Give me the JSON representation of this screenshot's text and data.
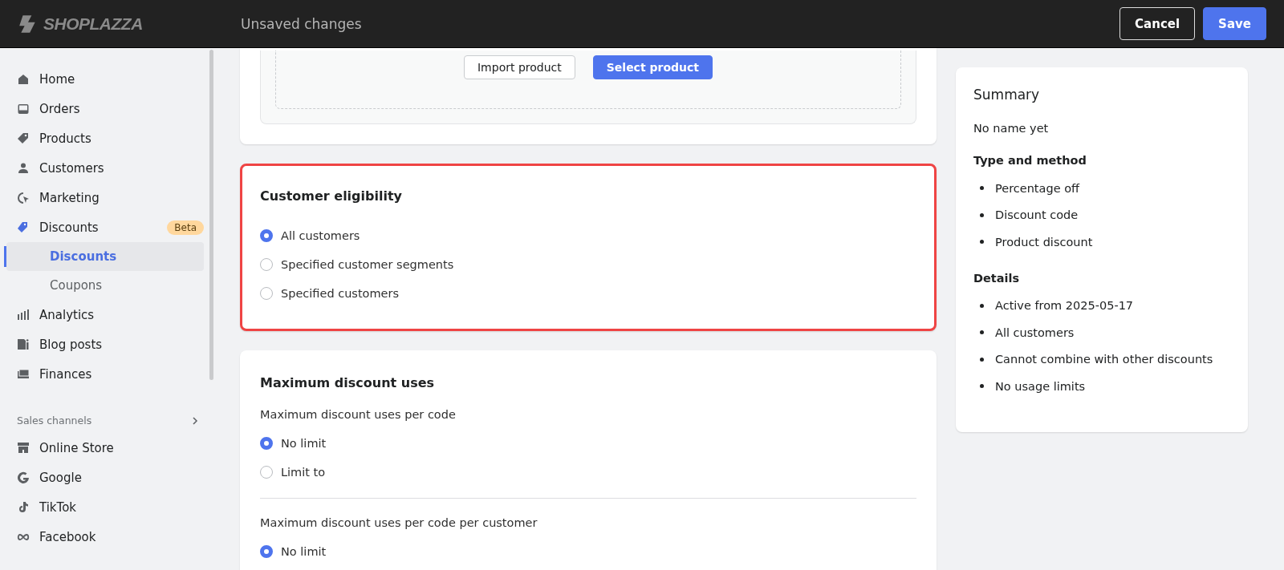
{
  "topbar": {
    "logo": "SHOPLAZZA",
    "title": "Unsaved changes",
    "buttons": [
      {
        "label": "Cancel",
        "kind": "secondary"
      },
      {
        "label": "Save",
        "kind": "primary"
      }
    ]
  },
  "sidebar": {
    "items": [
      {
        "label": "Home",
        "selected": false
      },
      {
        "label": "Orders",
        "selected": false
      },
      {
        "label": "Products",
        "selected": false
      },
      {
        "label": "Customers",
        "selected": false
      },
      {
        "label": "Marketing",
        "selected": false
      },
      {
        "label": "Discounts",
        "selected": false,
        "badge": "Beta",
        "children": [
          {
            "label": "Discounts",
            "selected": true
          },
          {
            "label": "Coupons",
            "selected": false
          }
        ]
      },
      {
        "label": "Analytics",
        "selected": false
      },
      {
        "label": "Blog posts",
        "selected": false
      },
      {
        "label": "Finances",
        "selected": false
      }
    ],
    "section": "Sales channels",
    "channels": [
      {
        "label": "Online Store"
      },
      {
        "label": "Google"
      },
      {
        "label": "TikTok"
      },
      {
        "label": "Facebook"
      }
    ]
  },
  "product_card": {
    "buttons": [
      {
        "label": "Import product",
        "kind": "secondary"
      },
      {
        "label": "Select product",
        "kind": "primary"
      }
    ]
  },
  "eligibility": {
    "title": "Customer eligibility",
    "highlighted": true,
    "options": [
      {
        "label": "All customers",
        "selected": true
      },
      {
        "label": "Specified customer segments",
        "selected": false
      },
      {
        "label": "Specified customers",
        "selected": false
      }
    ]
  },
  "max_uses": {
    "title": "Maximum discount uses",
    "groups": [
      {
        "label": "Maximum discount uses per code",
        "options": [
          {
            "label": "No limit",
            "selected": true
          },
          {
            "label": "Limit to",
            "selected": false
          }
        ]
      },
      {
        "label": "Maximum discount uses per code per customer",
        "options": [
          {
            "label": "No limit",
            "selected": true
          }
        ]
      }
    ]
  },
  "summary": {
    "title": "Summary",
    "name": "No name yet",
    "sections": [
      {
        "heading": "Type and method",
        "items": [
          "Percentage off",
          "Discount code",
          "Product discount"
        ]
      },
      {
        "heading": "Details",
        "items": [
          "Active from 2025-05-17",
          "All customers",
          "Cannot combine with other discounts",
          "No usage limits"
        ]
      }
    ]
  }
}
